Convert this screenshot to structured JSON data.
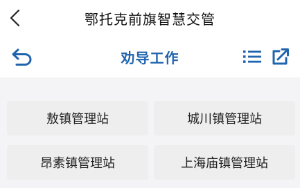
{
  "header": {
    "title": "鄂托克前旗智慧交管",
    "back_icon": "chevron-left-icon"
  },
  "toolbar": {
    "title": "劝导工作",
    "undo_icon": "undo-arrow-icon",
    "list_icon": "list-icon",
    "share_icon": "share-icon",
    "accent_color": "#1f64ad"
  },
  "stations": [
    {
      "label": "敖镇管理站"
    },
    {
      "label": "城川镇管理站"
    },
    {
      "label": "昂素镇管理站"
    },
    {
      "label": "上海庙镇管理站"
    }
  ]
}
